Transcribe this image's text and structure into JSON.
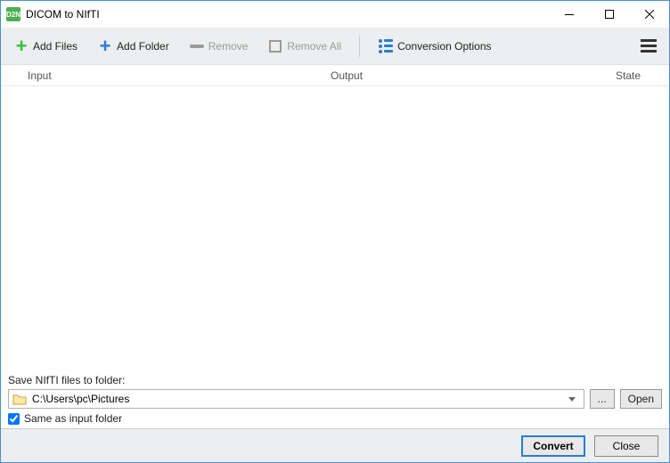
{
  "window": {
    "title": "DICOM to NIfTI",
    "icon_text": "D2N"
  },
  "toolbar": {
    "add_files": "Add Files",
    "add_folder": "Add Folder",
    "remove": "Remove",
    "remove_all": "Remove All",
    "conversion_options": "Conversion Options"
  },
  "columns": {
    "input": "Input",
    "output": "Output",
    "state": "State"
  },
  "save": {
    "label": "Save NIfTI files to folder:",
    "path": "C:\\Users\\pc\\Pictures",
    "browse": "...",
    "open": "Open",
    "same_as_input": "Same as input folder",
    "same_as_input_checked": true
  },
  "footer": {
    "convert": "Convert",
    "close": "Close"
  }
}
